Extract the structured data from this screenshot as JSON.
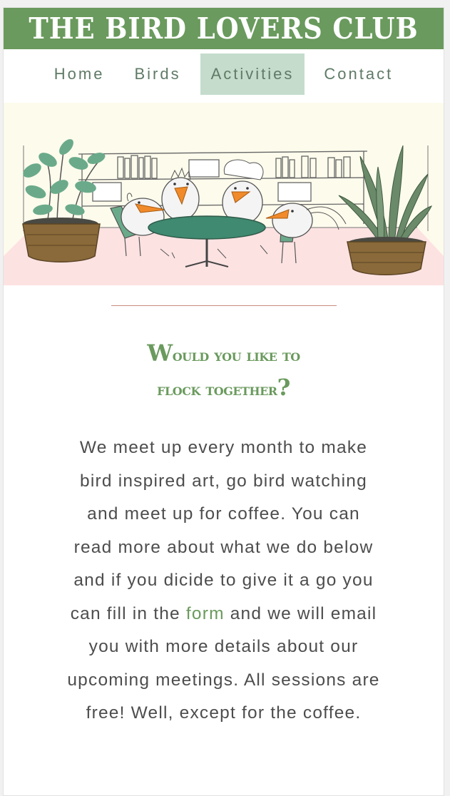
{
  "header": {
    "title": "THE BIRD LOVERS CLUB"
  },
  "nav": {
    "items": [
      {
        "label": "Home"
      },
      {
        "label": "Birds"
      },
      {
        "label": "Activities",
        "active": true
      },
      {
        "label": "Contact"
      }
    ]
  },
  "hero": {
    "image": "birds-around-table-illustration"
  },
  "section": {
    "heading_line1_cap": "W",
    "heading_line1_rest": "ould you like to",
    "heading_line2": "flock together",
    "heading_q": "?",
    "body_before": "We meet up every month to make bird inspired art, go bird watching and meet up for coffee. You can read more about what we do below and if you dicide to give it a go you can fill in the ",
    "body_link": "form",
    "body_after": " and we will email you with more details about our upcoming meetings. All sessions are free! Well, except for the coffee."
  },
  "colors": {
    "brand_green": "#6a9a5d",
    "nav_active_bg": "#c5dccd",
    "divider": "#c98a80",
    "hero_floor": "#fde2e2"
  }
}
